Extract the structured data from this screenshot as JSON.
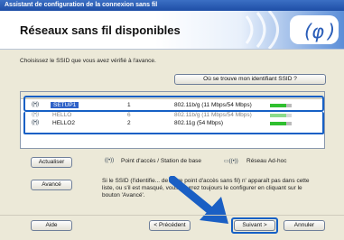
{
  "window": {
    "title": "Assistant de configuration de la connexion sans fil"
  },
  "header": {
    "title": "Réseaux sans fil disponibles"
  },
  "instruction": "Choisissez le SSID que vous avez vérifié à l'avance.",
  "ssid_button": "Où se trouve mon identifiant SSID ?",
  "networks": [
    {
      "ssid": "SETUP1",
      "channel": "1",
      "standard": "802.11b/g (11 Mbps/54 Mbps)",
      "selected": true
    },
    {
      "ssid": "HELLO",
      "channel": "6",
      "standard": "802.11b/g (11 Mbps/54 Mbps)",
      "selected": false
    },
    {
      "ssid": "HELLO2",
      "channel": "2",
      "standard": "802.11g (54 Mbps)",
      "selected": false
    }
  ],
  "buttons": {
    "refresh": "Actualiser",
    "advanced": "Avancé",
    "help": "Aide",
    "previous": "< Précédent",
    "next": "Suivant >",
    "cancel": "Annuler"
  },
  "legend": {
    "access_point": "Point d'accès / Station de base",
    "adhoc": "Réseau Ad-hoc"
  },
  "note": "Si le SSID (l'identifie... de votre point d'accès sans fil) n' apparaît pas dans cette liste, ou s'il est masqué, vous pourrez toujours le configurer en cliquant sur le bouton 'Avancé'.",
  "colors": {
    "accent": "#1660c5",
    "selection": "#2f62c8",
    "arrow": "#1a5fc4"
  }
}
